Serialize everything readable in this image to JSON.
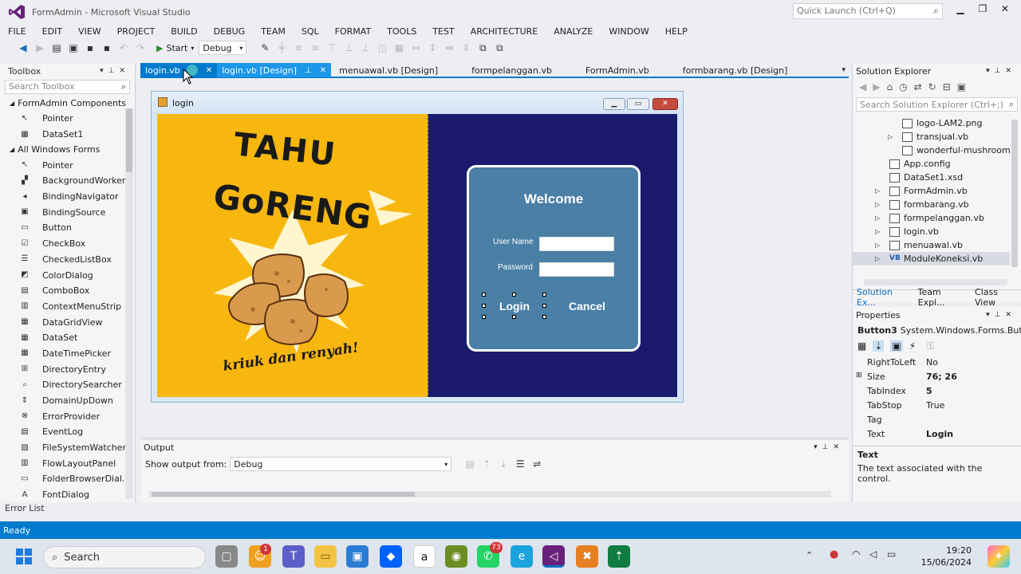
{
  "window": {
    "title": "FormAdmin - Microsoft Visual Studio",
    "quick_launch_placeholder": "Quick Launch (Ctrl+Q)"
  },
  "menu": [
    "FILE",
    "EDIT",
    "VIEW",
    "PROJECT",
    "BUILD",
    "DEBUG",
    "TEAM",
    "SQL",
    "FORMAT",
    "TOOLS",
    "TEST",
    "ARCHITECTURE",
    "ANALYZE",
    "WINDOW",
    "HELP"
  ],
  "toolbar": {
    "start_label": "Start",
    "config": "Debug"
  },
  "toolbox": {
    "title": "Toolbox",
    "search_placeholder": "Search Toolbox",
    "group1": "FormAdmin Components",
    "group1_items": [
      "Pointer",
      "DataSet1"
    ],
    "group2": "All Windows Forms",
    "group2_items": [
      "Pointer",
      "BackgroundWorker",
      "BindingNavigator",
      "BindingSource",
      "Button",
      "CheckBox",
      "CheckedListBox",
      "ColorDialog",
      "ComboBox",
      "ContextMenuStrip",
      "DataGridView",
      "DataSet",
      "DateTimePicker",
      "DirectoryEntry",
      "DirectorySearcher",
      "DomainUpDown",
      "ErrorProvider",
      "EventLog",
      "FileSystemWatcher",
      "FlowLayoutPanel",
      "FolderBrowserDial...",
      "FontDialog"
    ]
  },
  "error_list": "Error List",
  "tabs": [
    "login.vb",
    "login.vb [Design]",
    "menuawal.vb [Design]",
    "formpelanggan.vb",
    "FormAdmin.vb",
    "formbarang.vb [Design]"
  ],
  "form": {
    "title": "login",
    "brand_line1": "TAHU",
    "brand_line2": "GoRENG",
    "tagline": "kriuk dan renyah!",
    "welcome": "Welcome",
    "username_label": "User Name",
    "password_label": "Password",
    "login_button": "Login",
    "cancel_button": "Cancel"
  },
  "solution_explorer": {
    "title": "Solution Explorer",
    "search_placeholder": "Search Solution Explorer (Ctrl+;)",
    "items": [
      "logo-LAM2.png",
      "transjual.vb",
      "wonderful-mushroom",
      "App.config",
      "DataSet1.xsd",
      "FormAdmin.vb",
      "formbarang.vb",
      "formpelanggan.vb",
      "login.vb",
      "menuawal.vb",
      "ModuleKoneksi.vb"
    ],
    "tabs": [
      "Solution Ex...",
      "Team Expl...",
      "Class View"
    ]
  },
  "properties": {
    "title": "Properties",
    "object": "Button3",
    "object_type": "System.Windows.Forms.But",
    "rows": [
      {
        "name": "RightToLeft",
        "value": "No"
      },
      {
        "name": "Size",
        "value": "76; 26"
      },
      {
        "name": "TabIndex",
        "value": "5"
      },
      {
        "name": "TabStop",
        "value": "True"
      },
      {
        "name": "Tag",
        "value": ""
      },
      {
        "name": "Text",
        "value": "Login"
      }
    ],
    "desc_title": "Text",
    "desc_text": "The text associated with the control."
  },
  "output": {
    "title": "Output",
    "show_from_label": "Show output from:",
    "source": "Debug"
  },
  "status": "Ready",
  "taskbar": {
    "search": "Search",
    "time": "19:20",
    "date": "15/06/2024",
    "badge_teams": "1",
    "badge_whatsapp": "73"
  }
}
